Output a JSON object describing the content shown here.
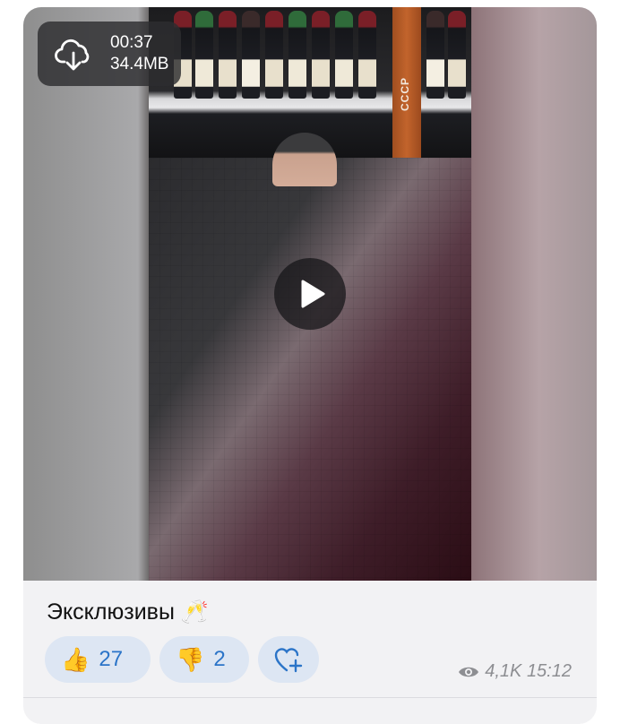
{
  "media": {
    "duration": "00:37",
    "size": "34.4MB",
    "download_icon": "cloud-download-icon",
    "play_icon": "play-icon",
    "pillar_text": "СССР"
  },
  "caption": {
    "text": "Эксклюзивы",
    "emoji": "🥂"
  },
  "reactions": [
    {
      "emoji": "👍",
      "count": "27",
      "icon": "thumbs-up-icon"
    },
    {
      "emoji": "👎",
      "count": "2",
      "icon": "thumbs-down-icon"
    },
    {
      "icon": "heart-add-icon"
    }
  ],
  "footer": {
    "views": "4,1K",
    "time": "15:12"
  },
  "colors": {
    "reaction_bg": "#dde6f3",
    "reaction_text": "#2b74c8",
    "meta_text": "#8d8e92"
  }
}
